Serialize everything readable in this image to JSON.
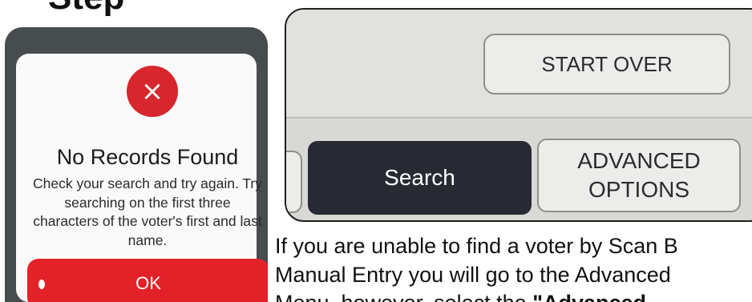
{
  "top_strip": {
    "text": "Step"
  },
  "dialog": {
    "close_symbol": "×",
    "title": "No Records Found",
    "message": "Check your search and try again. Try searching on the first three characters of the voter's first and last name.",
    "ok_label": "OK"
  },
  "screen2": {
    "start_over_label": "START OVER",
    "search_label": "Search",
    "advanced_label_line1": "ADVANCED",
    "advanced_label_line2": "OPTIONS"
  },
  "body": {
    "line1": "If you are unable to find a voter by Scan B",
    "line2": "Manual Entry you will go to the Advanced",
    "line3_a": "Menu, however, select the ",
    "line3_b": "\"Advanced"
  },
  "colors": {
    "dialog_red": "#e32128",
    "search_dark": "#272a33",
    "phone_frame": "#474d4f"
  }
}
